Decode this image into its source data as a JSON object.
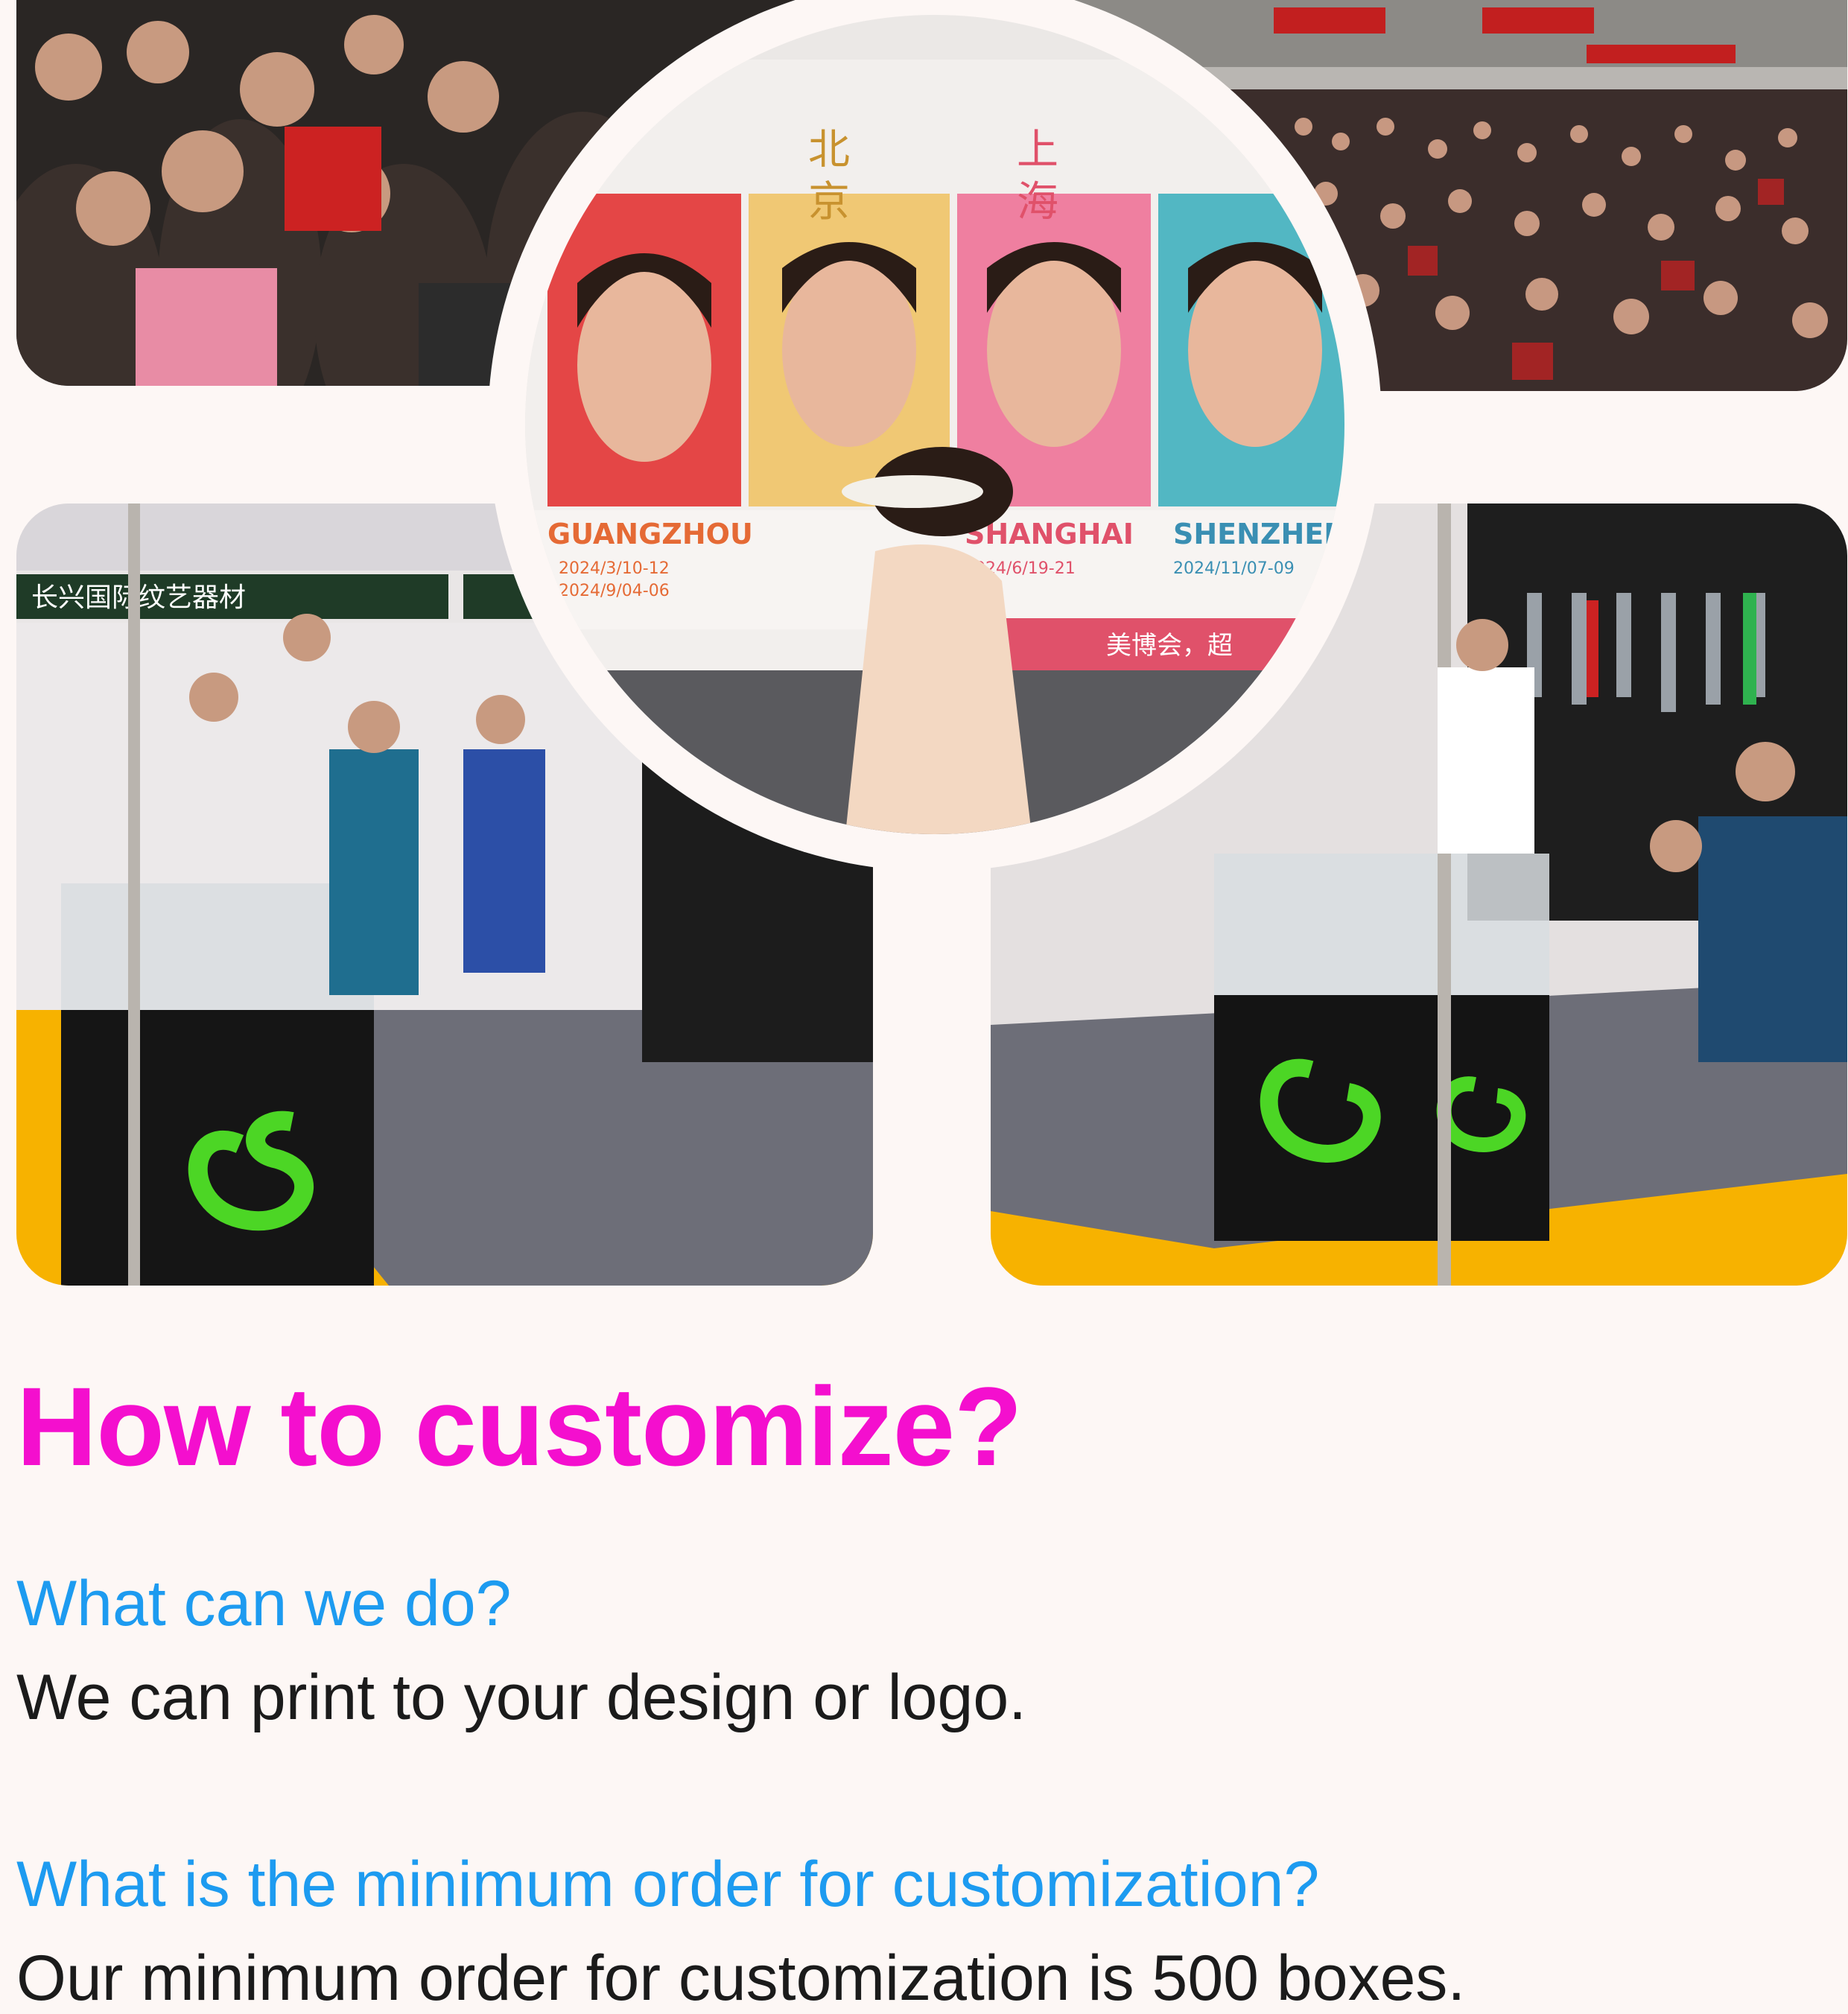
{
  "photos": {
    "top_left": {
      "label": "exhibition-crowd-photo"
    },
    "top_right": {
      "label": "exhibition-hall-crowd-photo"
    },
    "center": {
      "label": "beauty-expo-poster-photo",
      "city_chars": [
        "北",
        "京",
        "上",
        "海"
      ],
      "cities": [
        "GUANGZHOU",
        "SHANGHAI",
        "SHENZHEN"
      ],
      "dates": [
        "2024/3/10-12",
        "2024/9/04-06",
        "2024/6/19-21",
        "2024/11/07-09"
      ],
      "banner_text": "美博会，超"
    },
    "bottom_left": {
      "label": "tattoo-booth-photo",
      "booth_sign": "长兴国际纹艺器材"
    },
    "bottom_right": {
      "label": "tattoo-booth-photo-2"
    }
  },
  "faq": {
    "title": "How to customize?",
    "items": [
      {
        "question": "What can we do?",
        "answer": "We can print to your design or logo."
      },
      {
        "question": "What is the minimum order for customization?",
        "answer": "Our minimum order for customization is 500 boxes."
      }
    ]
  },
  "colors": {
    "title": "#f40fce",
    "question": "#1d9bf0",
    "answer": "#1b1b1b",
    "background": "#fdf7f5",
    "booth_floor": "#f7b200",
    "dragon": "#4cd625"
  }
}
